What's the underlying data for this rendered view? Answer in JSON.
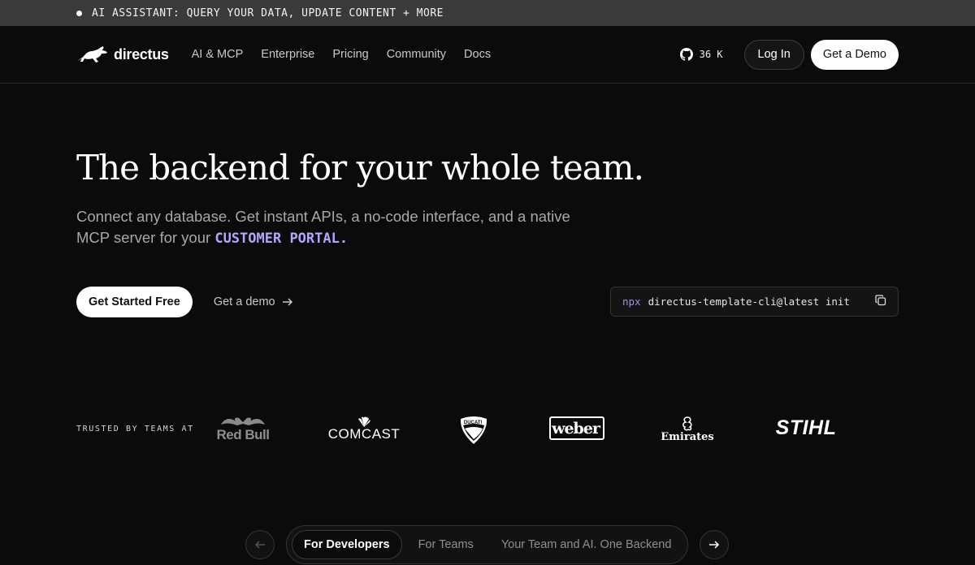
{
  "announcement": {
    "text": "AI ASSISTANT: QUERY YOUR DATA, UPDATE CONTENT + MORE"
  },
  "nav": {
    "brand": "directus",
    "links": [
      "AI & MCP",
      "Enterprise",
      "Pricing",
      "Community",
      "Docs"
    ],
    "github_stars": "36 K",
    "login_label": "Log In",
    "demo_label": "Get a Demo"
  },
  "hero": {
    "title": "The backend for your whole team.",
    "subtitle_prefix": "Connect any database. Get instant APIs, a no-code interface, and a native MCP server for your",
    "subtitle_highlight": "CUSTOMER PORTAL.",
    "primary_cta": "Get Started Free",
    "secondary_cta": "Get a demo",
    "cli_prefix": "npx",
    "cli_command": "directus-template-cli@latest init"
  },
  "trusted": {
    "label": "TRUSTED BY TEAMS AT",
    "logos": [
      "Red Bull",
      "COMCAST",
      "DUCATI",
      "weber",
      "Emirates",
      "STIHL"
    ]
  },
  "audience_tabs": {
    "items": [
      "For Developers",
      "For Teams",
      "Your Team and AI. One Backend"
    ],
    "active_index": 0
  },
  "icons": {
    "announce": "dot-icon",
    "github": "github-icon",
    "copy": "copy-icon",
    "arrow": "arrow-right-icon"
  },
  "colors": {
    "background": "#0b0b0c",
    "accent": "#b4a6ff",
    "announce_bar": "#3a3a3a"
  }
}
